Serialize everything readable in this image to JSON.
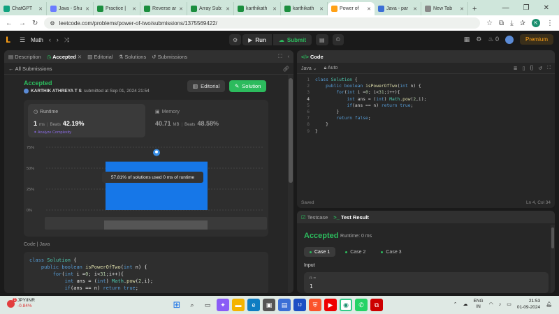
{
  "browser": {
    "tabs": [
      {
        "label": "ChatGPT",
        "color": "#10a37f"
      },
      {
        "label": "Java - Shu",
        "color": "#6b7cff"
      },
      {
        "label": "Practice |",
        "color": "#1b8e3e"
      },
      {
        "label": "Reverse ar",
        "color": "#1b8e3e"
      },
      {
        "label": "Array Sub:",
        "color": "#1b8e3e"
      },
      {
        "label": "karthikath",
        "color": "#1b8e3e"
      },
      {
        "label": "karthikath",
        "color": "#1b8e3e"
      },
      {
        "label": "Power of",
        "color": "#ffa116",
        "active": true
      },
      {
        "label": "Java - par",
        "color": "#3b6fd6"
      },
      {
        "label": "New Tab",
        "color": "#888888"
      }
    ],
    "url": "leetcode.com/problems/power-of-two/submissions/1375569422/",
    "profile_letter": "K"
  },
  "nav": {
    "title": "Math",
    "run_label": "Run",
    "submit_label": "Submit",
    "streak": "0",
    "premium_label": "Premium"
  },
  "left": {
    "tabs": [
      "Description",
      "Accepted",
      "Editorial",
      "Solutions",
      "Submissions"
    ],
    "back_label": "All Submissions",
    "status": "Accepted",
    "user": "KARTHIK ATHREYA T S",
    "submitted": "submitted at Sep 01, 2024 21:54",
    "editorial_btn": "Editorial",
    "solution_btn": "Solution",
    "runtime": {
      "label": "Runtime",
      "value": "1",
      "unit": "ms",
      "beats_label": "Beats",
      "beats": "42.19%",
      "analyze": "Analyze Complexity"
    },
    "memory": {
      "label": "Memory",
      "value": "40.71",
      "unit": "MB",
      "beats_label": "Beats",
      "beats": "48.58%"
    },
    "tooltip": "57.81% of solutions used 0 ms of runtime",
    "code_label": "Code",
    "code_lang": "Java"
  },
  "chart_data": {
    "type": "bar",
    "y_ticks": [
      "75%",
      "50%",
      "25%",
      "0%"
    ],
    "ylim": [
      0,
      75
    ],
    "bars": [
      {
        "category": "0 ms",
        "value": 57.81,
        "color": "#1677e8"
      }
    ],
    "annotation": "57.81% of solutions used 0 ms of runtime"
  },
  "code_panel": {
    "title": "Code",
    "language": "Java",
    "autosave": "Auto",
    "saved": "Saved",
    "cursor": "Ln 4, Col 34"
  },
  "code_lines": [
    "class Solution {",
    "    public boolean isPowerOfTwo(int n) {",
    "        for(int i =0; i<31;i++){",
    "            int ans = (int) Math.pow(2,i);",
    "            if(ans == n) return true;",
    "        }",
    "        return false;",
    "    }",
    "}"
  ],
  "test_panel": {
    "tab_testcase": "Testcase",
    "tab_result": "Test Result",
    "status": "Accepted",
    "runtime": "Runtime: 0 ms",
    "cases": [
      "Case 1",
      "Case 2",
      "Case 3"
    ],
    "input_label": "Input",
    "var_name": "n =",
    "var_value": "1"
  },
  "taskbar": {
    "ticker": "JPY/INR",
    "change": "-0.84%",
    "lang1": "ENG",
    "lang2": "IN",
    "time": "21:53",
    "date": "01-09-2024"
  }
}
